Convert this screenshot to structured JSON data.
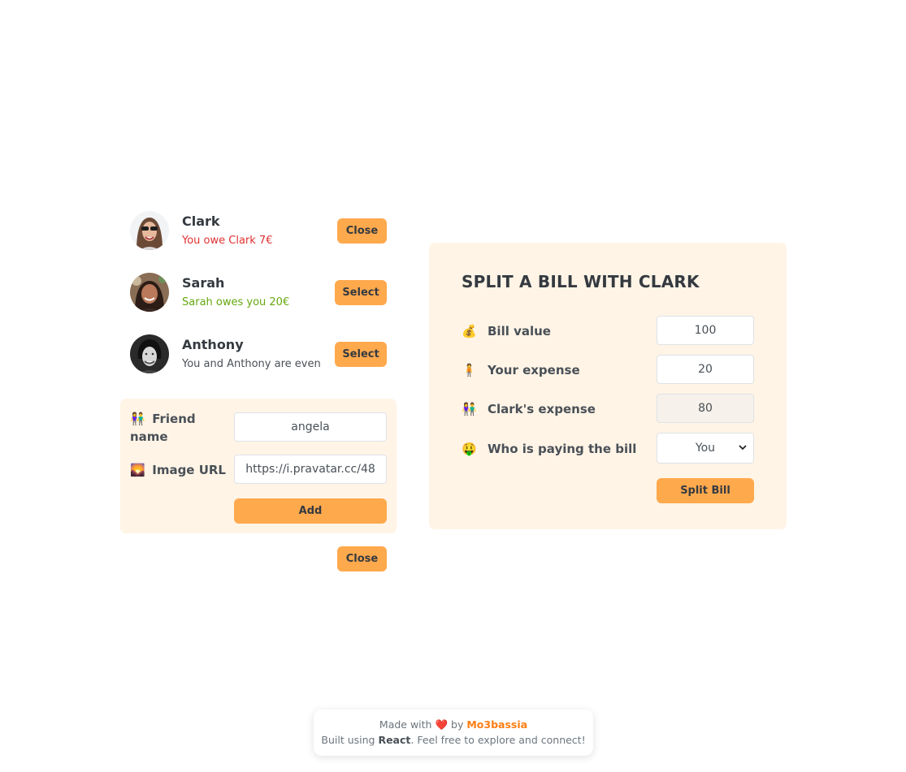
{
  "friends": [
    {
      "name": "Clark",
      "status": "You owe Clark 7€",
      "status_type": "red",
      "button_label": "Close",
      "selected": true
    },
    {
      "name": "Sarah",
      "status": "Sarah owes you 20€",
      "status_type": "green",
      "button_label": "Select",
      "selected": false
    },
    {
      "name": "Anthony",
      "status": "You and Anthony are even",
      "status_type": "even",
      "button_label": "Select",
      "selected": false
    }
  ],
  "add_form": {
    "friend_name_icon": "👫",
    "friend_name_label": "Friend name",
    "friend_name_value": "angela",
    "image_url_icon": "🌄",
    "image_url_label": "Image URL",
    "image_url_value": "https://i.pravatar.cc/48",
    "add_label": "Add"
  },
  "close_add_label": "Close",
  "split_form": {
    "title": "SPLIT A BILL WITH CLARK",
    "bill_icon": "💰",
    "bill_label": "Bill value",
    "bill_value": "100",
    "your_icon": "🧍",
    "your_label": "Your expense",
    "your_value": "20",
    "friend_icon": "👫",
    "friend_label": "Clark's expense",
    "friend_value": "80",
    "payer_icon": "🤑",
    "payer_label": "Who is paying the bill",
    "payer_value": "You",
    "submit_label": "Split Bill"
  },
  "footer": {
    "made_with": "Made with",
    "heart": "❤️",
    "by": "by",
    "author": "Mo3bassia",
    "built_using": "Built using",
    "tech": "React",
    "rest": ". Feel free to explore and connect!"
  },
  "colors": {
    "accent": "#ffa94d",
    "panel": "#fff4e6",
    "red": "#e03131",
    "green": "#66a80f",
    "author": "#fd7e14"
  }
}
